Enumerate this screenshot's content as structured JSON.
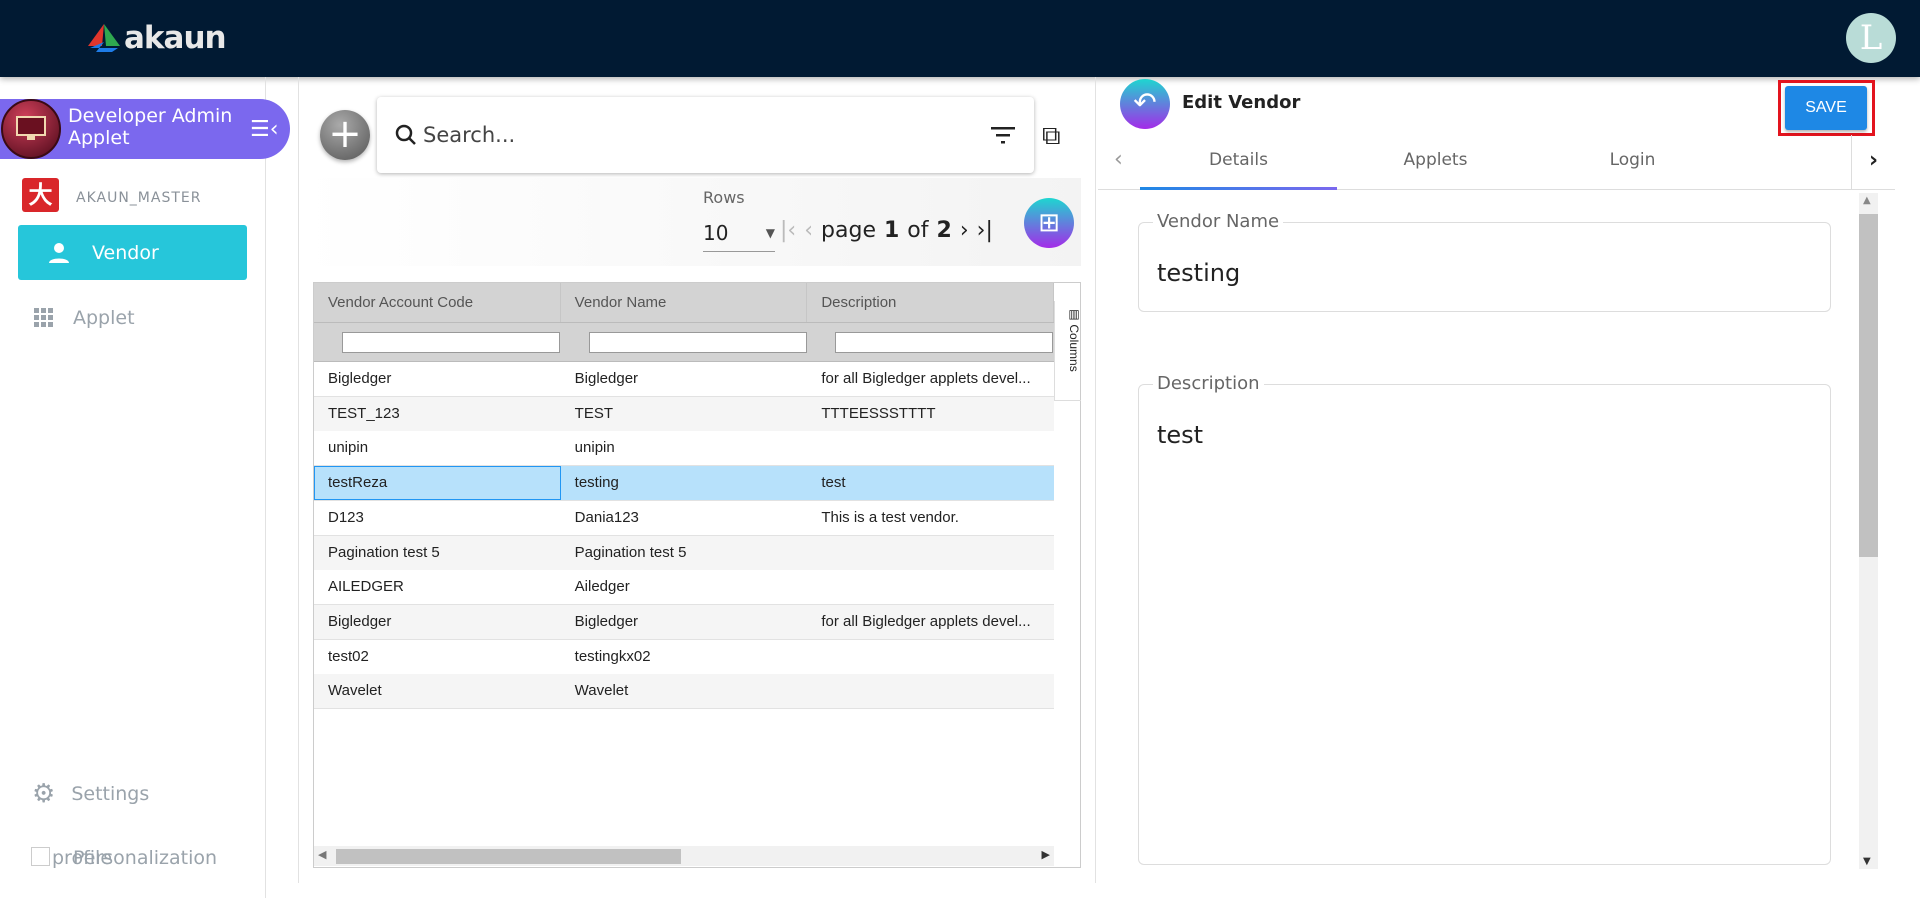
{
  "header": {
    "logo_text": "akaun",
    "user_avatar_letter": "L"
  },
  "sidebar": {
    "applet_title": "Developer Admin Applet",
    "master_label": "AKAUN_MASTER",
    "items": [
      {
        "label": "Vendor",
        "icon": "person-icon",
        "active": true
      },
      {
        "label": "Applet",
        "icon": "grid-icon"
      }
    ],
    "settings_label": "Settings",
    "profile_label": "profile",
    "personalization_label": "Personalization"
  },
  "search": {
    "placeholder": "Search..."
  },
  "pagination": {
    "rows_label": "Rows",
    "rows_value": "10",
    "page_word": "page",
    "current_page": "1",
    "of_word": "of",
    "total_pages": "2"
  },
  "table": {
    "columns": [
      "Vendor Account Code",
      "Vendor Name",
      "Description"
    ],
    "columns_tab": "Columns",
    "rows": [
      [
        "Bigledger",
        "Bigledger",
        "for all Bigledger applets devel..."
      ],
      [
        "TEST_123",
        "TEST",
        "TTTEESSSTTTT"
      ],
      [
        "unipin",
        "unipin",
        ""
      ],
      [
        "testReza",
        "testing",
        "test"
      ],
      [
        "D123",
        "Dania123",
        "This is a test vendor."
      ],
      [
        "Pagination test 5",
        "Pagination test 5",
        ""
      ],
      [
        "AILEDGER",
        "Ailedger",
        ""
      ],
      [
        "Bigledger",
        "Bigledger",
        "for all Bigledger applets devel..."
      ],
      [
        "test02",
        "testingkx02",
        ""
      ],
      [
        "Wavelet",
        "Wavelet",
        ""
      ]
    ],
    "selected_row": 3
  },
  "edit": {
    "title": "Edit Vendor",
    "save_label": "SAVE",
    "tabs": [
      "Details",
      "Applets",
      "Login"
    ],
    "active_tab": 0,
    "vendor_name_label": "Vendor Name",
    "vendor_name_value": "testing",
    "description_label": "Description",
    "description_value": "test"
  },
  "colors": {
    "topbar": "#011a33",
    "accent_purple": "#7b68ee",
    "active_nav": "#26c6da",
    "save": "#1e88e5",
    "highlight": "#e3141e",
    "selected_row": "#b7e1fb"
  }
}
